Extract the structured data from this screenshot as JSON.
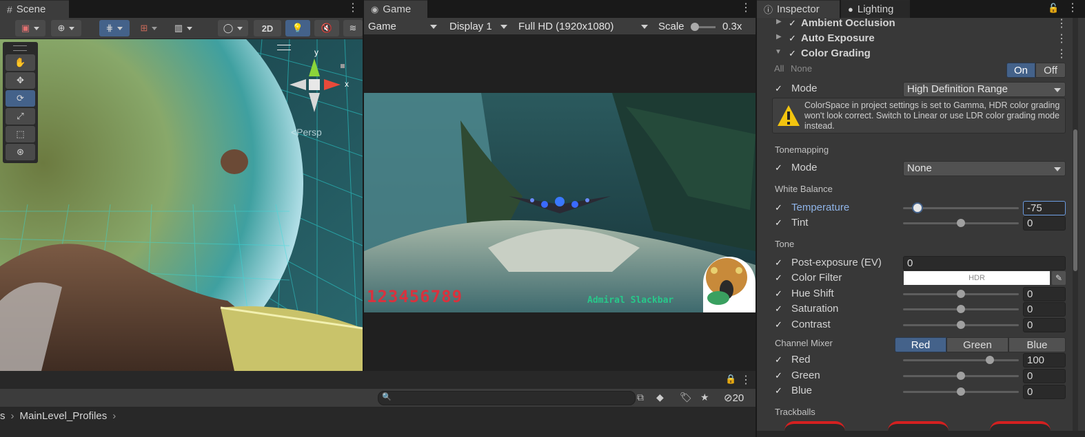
{
  "scene": {
    "tab_label": "Scene",
    "persp_label": "<Persp",
    "axis_y": "y",
    "axis_x": "x",
    "toolbar": {
      "btn_2d": "2D"
    },
    "tools": [
      "hand-tool",
      "move-tool",
      "rotate-tool",
      "scale-tool",
      "rect-tool",
      "transform-tool"
    ]
  },
  "game": {
    "tab_label": "Game",
    "mode_select": "Game",
    "display_select": "Display 1",
    "resolution_select": "Full HD (1920x1080)",
    "scale_label": "Scale",
    "scale_value": "0.3x",
    "hud_score": "123456789",
    "hud_name": "Admiral Slackbar"
  },
  "inspector": {
    "tab_label": "Inspector",
    "lighting_tab_label": "Lighting",
    "effects": [
      {
        "label": "Ambient Occlusion",
        "enabled": true,
        "expanded": false
      },
      {
        "label": "Auto Exposure",
        "enabled": true,
        "expanded": false
      },
      {
        "label": "Color Grading",
        "enabled": true,
        "expanded": true
      }
    ],
    "all_label": "All",
    "none_label": "None",
    "on_label": "On",
    "off_label": "Off",
    "mode_label": "Mode",
    "mode_value": "High Definition Range",
    "warning_text": "ColorSpace in project settings is set to Gamma, HDR color grading won't look correct. Switch to Linear or use LDR color grading mode instead.",
    "tonemapping_header": "Tonemapping",
    "tonemapping_mode_label": "Mode",
    "tonemapping_mode_value": "None",
    "white_balance_header": "White Balance",
    "temperature_label": "Temperature",
    "temperature_value": "-75",
    "temperature_level": 0.125,
    "tint_label": "Tint",
    "tint_value": "0",
    "tint_level": 0.5,
    "tone_header": "Tone",
    "post_exposure_label": "Post-exposure (EV)",
    "post_exposure_value": "0",
    "color_filter_label": "Color Filter",
    "color_filter_tag": "HDR",
    "color_filter_color": "#ffffff",
    "hue_shift_label": "Hue Shift",
    "hue_shift_value": "0",
    "saturation_label": "Saturation",
    "saturation_value": "0",
    "contrast_label": "Contrast",
    "contrast_value": "0",
    "channel_mixer_header": "Channel Mixer",
    "mixer_tabs": [
      "Red",
      "Green",
      "Blue"
    ],
    "mixer_active": "Red",
    "red_label": "Red",
    "red_value": "100",
    "red_level": 0.75,
    "green_label": "Green",
    "green_value": "0",
    "blue_label": "Blue",
    "blue_value": "0",
    "trackballs_header": "Trackballs"
  },
  "project": {
    "breadcrumb_prev": "s",
    "breadcrumb_current": "MainLevel_Profiles",
    "search_placeholder": "",
    "hidden_count": "20"
  },
  "colors": {
    "accent": "#44628a",
    "highlight_text": "#8fb4e8",
    "warning": "#f2c40f",
    "grid": "#2ad6d6"
  }
}
